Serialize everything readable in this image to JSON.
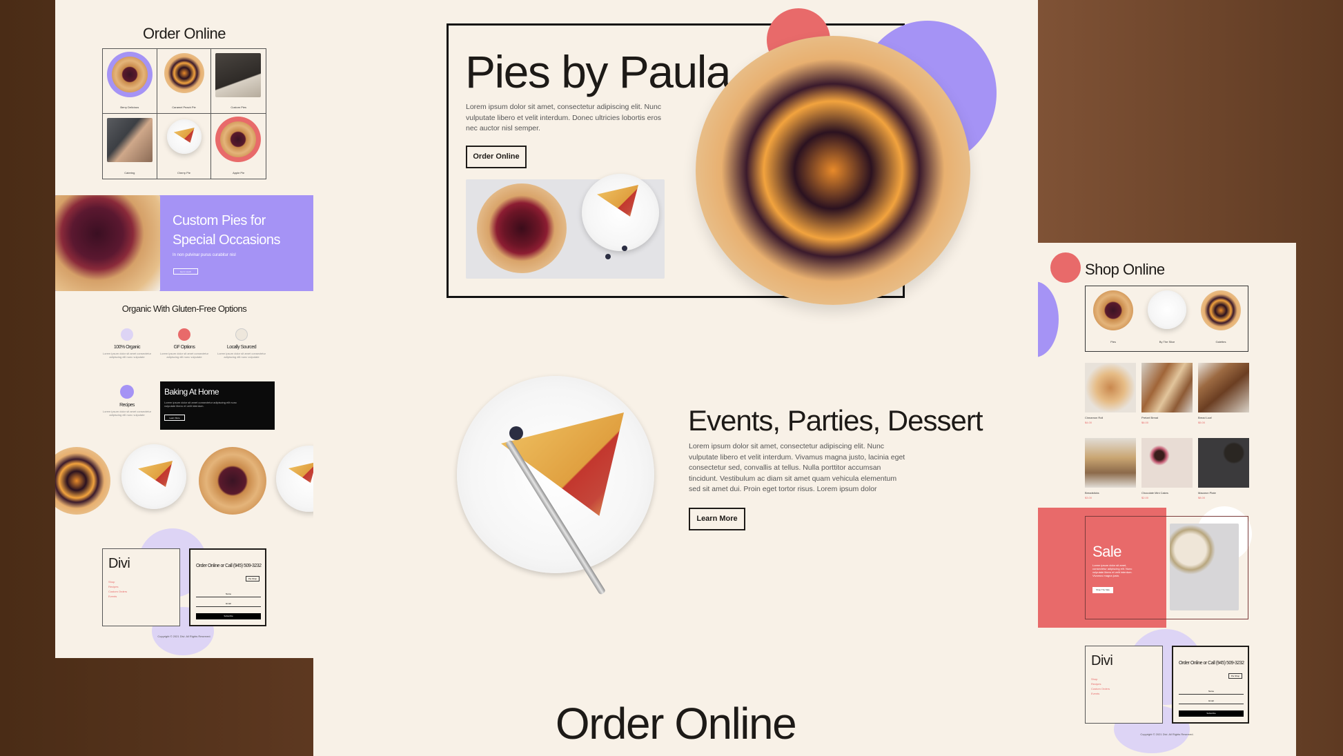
{
  "left_panel": {
    "order_title": "Order Online",
    "grid_items": [
      "Berry Delicious",
      "Caramel Peach Pie",
      "Custom Pies",
      "Catering",
      "Cherry Pie",
      "Apple Pie"
    ],
    "custom_title_1": "Custom Pies for",
    "custom_title_2": "Special Occasions",
    "custom_sub": "In non pulvinar purus curabitur nisl",
    "custom_btn": "Get in touch",
    "organic_title": "Organic With Gluten-Free Options",
    "features": [
      "100% Organic",
      "GF Options",
      "Locally Sourced",
      "Recipes"
    ],
    "baking_title": "Baking At Home",
    "baking_btn": "Learn More",
    "footer_logo": "Divi",
    "footer_links": [
      "Shop",
      "Recipes",
      "Custom Orders",
      "Events"
    ],
    "footer_call": "Order Online or Call (945) 509-3232",
    "footer_shop_btn": "Pie Shop",
    "footer_name": "Name",
    "footer_email": "Email",
    "footer_subscribe": "Subscribe",
    "copyright": "Copyright © 2021 Divi. All Rights Reserved."
  },
  "hero": {
    "title": "Pies by Paula",
    "body": "Lorem ipsum dolor sit amet, consectetur adipiscing elit. Nunc vulputate libero et velit interdum. Donec ultricies lobortis eros nec auctor nisl semper.",
    "button": "Order Online"
  },
  "events": {
    "title": "Events, Parties, Dessert",
    "body": "Lorem ipsum dolor sit amet, consectetur adipiscing elit. Nunc vulputate libero et velit interdum. Vivamus magna justo, lacinia eget consectetur sed, convallis at tellus. Nulla porttitor accumsan tincidunt. Vestibulum ac diam sit amet quam vehicula elementum sed sit amet dui. Proin eget tortor risus. Lorem ipsum dolor",
    "button": "Learn More"
  },
  "bottom_title": "Order Online",
  "right_panel": {
    "shop_title": "Shop Online",
    "shop_items": [
      "Pies",
      "By The Slice",
      "Galettes"
    ],
    "products": [
      {
        "name": "Cinnamon Roll",
        "price": "$4.00"
      },
      {
        "name": "Pretzel Bread",
        "price": "$6.00"
      },
      {
        "name": "Bread Loaf",
        "price": "$5.00"
      },
      {
        "name": "Breadsticks",
        "price": "$3.00"
      },
      {
        "name": "Chocolate Mini Cakes",
        "price": "$2.00"
      },
      {
        "name": "Macaron Plate",
        "price": "$8.00"
      }
    ],
    "sale_title": "Sale",
    "sale_body": "Lorem ipsum dolor sit amet, consectetur adipiscing elit. Nunc vulputate libero et velit interdum. Vivamus magna justo.",
    "sale_btn": "Shop The Sale",
    "footer_logo": "Divi",
    "footer_links": [
      "Shop",
      "Recipes",
      "Custom Orders",
      "Events"
    ],
    "footer_call": "Order Online or Call (945) 509-3232",
    "footer_shop_btn": "Pie Shop",
    "footer_name": "Name",
    "footer_email": "Email",
    "footer_subscribe": "Subscribe",
    "copyright": "Copyright © 2021 Divi. All Rights Reserved."
  },
  "colors": {
    "cream": "#f8f1e7",
    "lavender": "#a593f5",
    "coral": "#e86a6a",
    "ink": "#1d1a17"
  }
}
